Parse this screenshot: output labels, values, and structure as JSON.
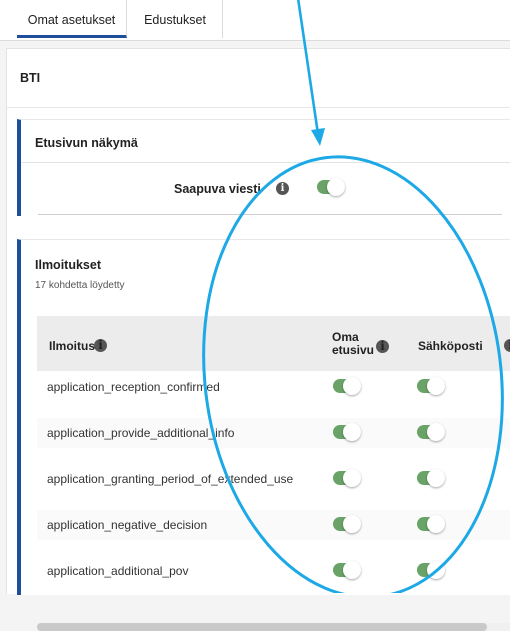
{
  "tabs": [
    {
      "label": "Omat asetukset",
      "active": true
    },
    {
      "label": "Edustukset",
      "active": false
    }
  ],
  "org": {
    "title": "BTI"
  },
  "front_page": {
    "title": "Etusivun näkymä",
    "row_label": "Saapuva viesti",
    "toggle_on": true
  },
  "notifications": {
    "title": "Ilmoitukset",
    "count_text": "17 kohdetta löydetty",
    "columns": {
      "notice": "Ilmoitus",
      "own_front_line1": "Oma",
      "own_front_line2": "etusivu",
      "email": "Sähköposti"
    },
    "rows": [
      {
        "code": "application_reception_confirmed",
        "own_front": true,
        "email": true
      },
      {
        "code": "application_provide_additional_info",
        "own_front": true,
        "email": true
      },
      {
        "code": "application_granting_period_of_extended_use",
        "own_front": true,
        "email": true
      },
      {
        "code": "application_negative_decision",
        "own_front": true,
        "email": true
      },
      {
        "code": "application_additional_pov",
        "own_front": true,
        "email": true
      }
    ]
  },
  "icons": {
    "info": "info-icon",
    "toggle": "toggle-switch"
  },
  "colors": {
    "accent": "#1f4f9c",
    "toggle_on": "#6aa368",
    "annotation": "#1da8e6"
  }
}
